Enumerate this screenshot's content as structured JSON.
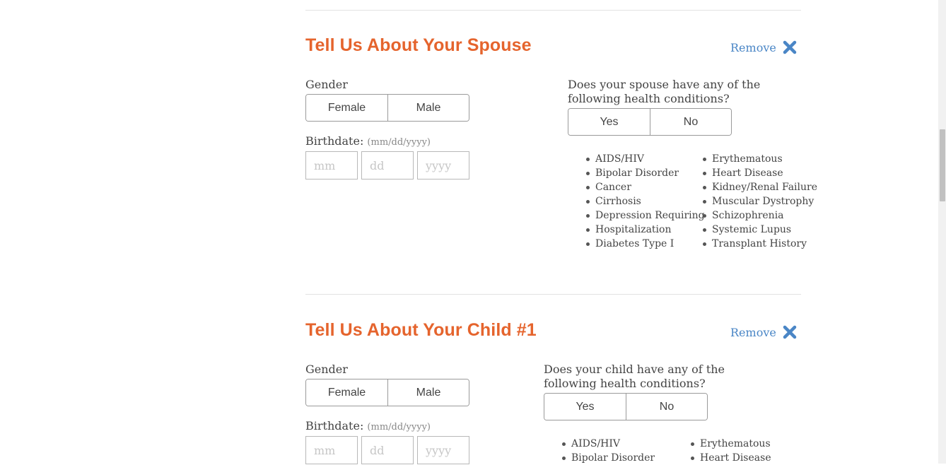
{
  "spouse": {
    "title": "Tell Us About Your Spouse",
    "remove_label": "Remove",
    "gender_label": "Gender",
    "gender_options": [
      "Female",
      "Male"
    ],
    "birthdate_label": "Birthdate:",
    "birthdate_hint": "(mm/dd/yyyy)",
    "birthdate_placeholders": {
      "month": "mm",
      "day": "dd",
      "year": "yyyy"
    },
    "health_question": "Does your spouse have any of the following health conditions?",
    "health_options": [
      "Yes",
      "No"
    ],
    "conditions_left": [
      "AIDS/HIV",
      "Bipolar Disorder",
      "Cancer",
      "Cirrhosis",
      "Depression Requiring",
      "Hospitalization",
      "Diabetes Type I"
    ],
    "conditions_right": [
      "Erythematous",
      "Heart Disease",
      "Kidney/Renal Failure",
      "Muscular Dystrophy",
      "Schizophrenia",
      "Systemic Lupus",
      "Transplant History"
    ]
  },
  "child1": {
    "title": "Tell Us About Your Child #1",
    "remove_label": "Remove",
    "gender_label": "Gender",
    "gender_options": [
      "Female",
      "Male"
    ],
    "birthdate_label": "Birthdate:",
    "birthdate_hint": "(mm/dd/yyyy)",
    "birthdate_placeholders": {
      "month": "mm",
      "day": "dd",
      "year": "yyyy"
    },
    "health_question": "Does your child have any of the following health conditions?",
    "health_options": [
      "Yes",
      "No"
    ],
    "conditions_left": [
      "AIDS/HIV",
      "Bipolar Disorder"
    ],
    "conditions_right": [
      "Erythematous",
      "Heart Disease"
    ]
  },
  "colors": {
    "accent": "#e5642d",
    "link": "#4a86c6",
    "border": "#9a9a9a",
    "text": "#444444"
  },
  "icons": {
    "remove": "close-x-icon"
  }
}
